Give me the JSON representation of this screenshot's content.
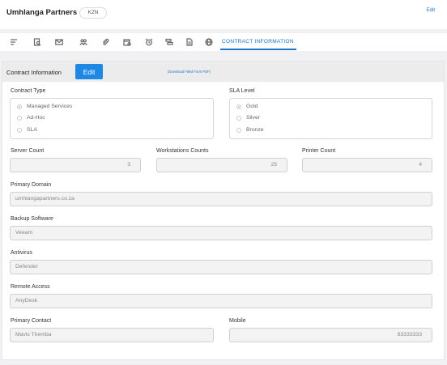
{
  "header": {
    "company_name": "Umhlanga Partners",
    "region_badge": "KZN",
    "edit_label": "Edit"
  },
  "tabs": {
    "icons": [
      "sort-icon",
      "document-search-icon",
      "mail-icon",
      "users-icon",
      "paperclip-icon",
      "calendar-icon",
      "alarm-clock-icon",
      "server-icon",
      "file-icon",
      "globe-icon"
    ],
    "active_label": "CONTRACT INFORMATION"
  },
  "panel": {
    "title": "Contract Information",
    "edit_button": "Edit",
    "download_link": "(Download Filled Form PDF)"
  },
  "contract_type": {
    "label": "Contract Type",
    "options": [
      "Managed Services",
      "Ad-Hoc",
      "SLA"
    ],
    "selected": "Managed Services"
  },
  "sla_level": {
    "label": "SLA Level",
    "options": [
      "Gold",
      "Silver",
      "Bronze"
    ],
    "selected": "Gold"
  },
  "server_count": {
    "label": "Server Count",
    "value": "3"
  },
  "workstations_count": {
    "label": "Workstations Counts",
    "value": "25"
  },
  "printer_count": {
    "label": "Printer Count",
    "value": "4"
  },
  "primary_domain": {
    "label": "Primary Domain",
    "value": "umhlangapartners.co.za"
  },
  "backup_software": {
    "label": "Backup Software",
    "value": "Veeam"
  },
  "antivirus": {
    "label": "Antivirus",
    "value": "Defender"
  },
  "remote_access": {
    "label": "Remote Access",
    "value": "AnyDesk"
  },
  "primary_contact": {
    "label": "Primary Contact",
    "value": "Mavis Themba"
  },
  "mobile": {
    "label": "Mobile",
    "value": "83333333"
  }
}
